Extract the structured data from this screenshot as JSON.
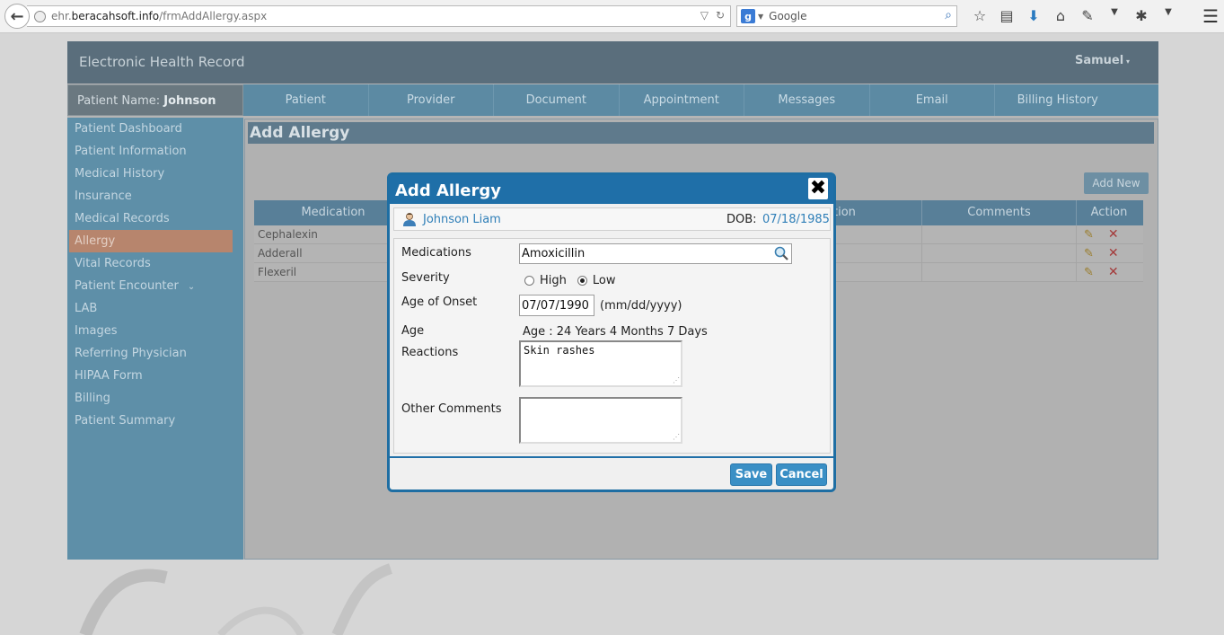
{
  "browser": {
    "url_prefix": "ehr.",
    "url_domain": "beracahsoft.info",
    "url_path": "/frmAddAllergy.aspx",
    "search_placeholder": "Google",
    "search_engine_letter": "g"
  },
  "app": {
    "title": "Electronic Health Record",
    "user": "Samuel",
    "patient_label": "Patient Name:",
    "patient_name": "Johnson"
  },
  "nav_tabs": [
    "Patient",
    "Provider",
    "Document",
    "Appointment",
    "Messages",
    "Email",
    "Billing History"
  ],
  "sidebar": {
    "items": [
      "Patient Dashboard",
      "Patient Information",
      "Medical History",
      "Insurance",
      "Medical Records",
      "Allergy",
      "Vital Records",
      "Patient Encounter",
      "LAB",
      "Images",
      "Referring Physician",
      "HIPAA Form",
      "Billing",
      "Patient Summary"
    ],
    "active": "Allergy"
  },
  "content": {
    "title": "Add Allergy",
    "add_new_label": "Add New",
    "columns": [
      "Medication",
      "",
      "",
      "tion",
      "Comments",
      "Action"
    ],
    "rows": [
      {
        "medication": "Cephalexin"
      },
      {
        "medication": "Adderall"
      },
      {
        "medication": "Flexeril"
      }
    ]
  },
  "modal": {
    "title": "Add Allergy",
    "patient_full_name": "Johnson Liam",
    "dob_label": "DOB:",
    "dob_value": "07/18/1985",
    "labels": {
      "medications": "Medications",
      "severity": "Severity",
      "age_of_onset": "Age of Onset",
      "age": "Age",
      "reactions": "Reactions",
      "other_comments": "Other Comments"
    },
    "medications_value": "Amoxicillin",
    "severity_options": [
      "High",
      "Low"
    ],
    "severity_selected": "Low",
    "age_of_onset_value": "07/07/1990",
    "date_format_hint": "(mm/dd/yyyy)",
    "age_value": "Age : 24 Years 4 Months 7 Days",
    "reactions_value": "Skin rashes",
    "other_comments_value": "",
    "save_label": "Save",
    "cancel_label": "Cancel"
  }
}
